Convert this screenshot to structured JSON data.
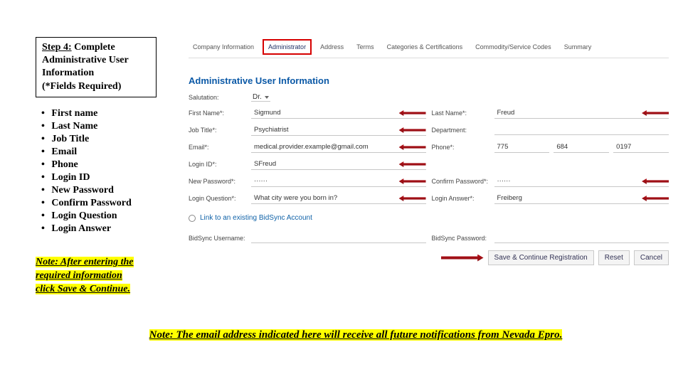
{
  "step": {
    "prefix": "Step 4:",
    "title_line1": " Complete",
    "title_line2": "Administrative User",
    "title_line3": "Information",
    "title_line4": "(*Fields Required)"
  },
  "bullets": [
    "First name",
    "Last Name",
    "Job Title",
    "Email",
    "Phone",
    "Login ID",
    "New Password",
    "Confirm Password",
    "Login Question",
    "Login Answer"
  ],
  "note1": {
    "l1": "Note: After entering the",
    "l2": "required information",
    "l3a": "click ",
    "l3b": "Save & Continue."
  },
  "note2": "Note: The email address indicated here will receive all future notifications from Nevada Epro.",
  "breadcrumb": [
    "Company Information",
    "Administrator",
    "Address",
    "Terms",
    "Categories & Certifications",
    "Commodity/Service Codes",
    "Summary"
  ],
  "section_title": "Administrative User Information",
  "form": {
    "salutation_label": "Salutation:",
    "salutation_value": "Dr.",
    "first_name_label": "First Name*:",
    "first_name_value": "Sigmund",
    "last_name_label": "Last Name*:",
    "last_name_value": "Freud",
    "job_title_label": "Job Title*:",
    "job_title_value": "Psychiatrist",
    "department_label": "Department:",
    "department_value": "",
    "email_label": "Email*:",
    "email_value": "medical.provider.example@gmail.com",
    "phone_label": "Phone*:",
    "phone_a": "775",
    "phone_b": "684",
    "phone_c": "0197",
    "login_id_label": "Login ID*:",
    "login_id_value": "SFreud",
    "new_pw_label": "New Password*:",
    "new_pw_value": "······",
    "confirm_pw_label": "Confirm Password*:",
    "confirm_pw_value": "······",
    "login_q_label": "Login Question*:",
    "login_q_value": "What city were you born in?",
    "login_a_label": "Login Answer*:",
    "login_a_value": "Freiberg",
    "link_text": "Link to an existing BidSync Account",
    "bs_user_label": "BidSync Username:",
    "bs_user_value": "",
    "bs_pw_label": "BidSync Password:",
    "bs_pw_value": ""
  },
  "buttons": {
    "save": "Save & Continue Registration",
    "reset": "Reset",
    "cancel": "Cancel"
  }
}
